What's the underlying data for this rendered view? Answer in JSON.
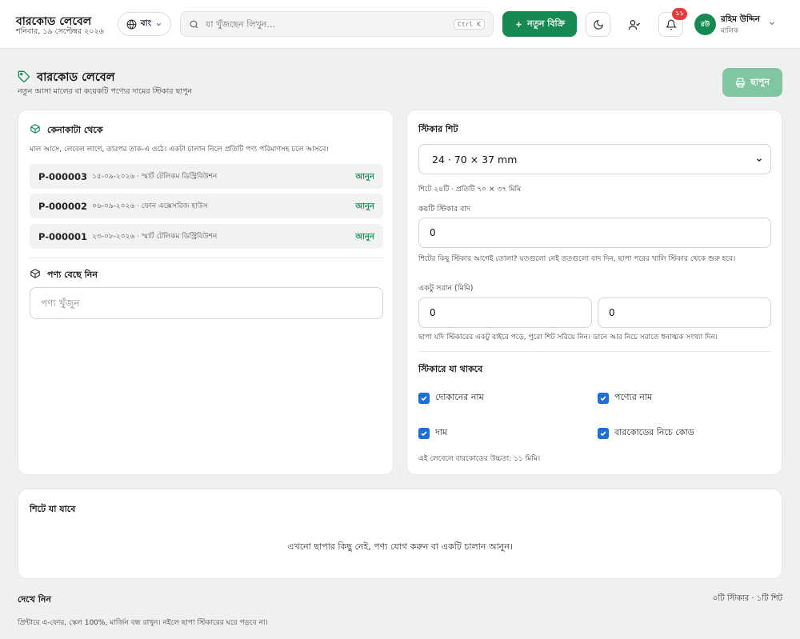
{
  "topbar": {
    "title": "বারকোড লেবেল",
    "date": "শনিবার, ১৯ সেপ্টেম্বর ২০২৬",
    "lang_label": "বাং",
    "search_placeholder": "যা খুঁজছেন লিখুন...",
    "search_shortcut": "Ctrl K",
    "new_sale_label": "নতুন বিক্রি",
    "notification_count": "১১",
    "user_initials": "রউ",
    "user_name": "রহিম উদ্দিন",
    "user_role": "মালিক"
  },
  "page": {
    "title": "বারকোড লেবেল",
    "subtitle": "নতুন আসা মালের বা কয়েকটি পণ্যের দামের স্টিকার ছাপুন",
    "print_label": "ছাপুন"
  },
  "purchases": {
    "title": "কেনাকাটা থেকে",
    "hint": "মাল আসে, লেবেল লাগে, তারপর তাক-এ ওঠে। একটা চালান নিলে প্রতিটি পণ্য পরিমাণসহ চলে আসবে।",
    "bring_label": "আনুন",
    "items": [
      {
        "code": "P-000003",
        "meta": "১৫-০৯-২০২৬ · স্মার্ট টেলিকম ডিস্ট্রিবিউশন"
      },
      {
        "code": "P-000002",
        "meta": "০৬-০৯-২০২৬ · ফোন এক্সেসরিজ হাউস"
      },
      {
        "code": "P-000001",
        "meta": "২৩-০৮-২০২৬ · স্মার্ট টেলিকম ডিস্ট্রিবিউশন"
      }
    ]
  },
  "product_pick": {
    "title": "পণ্য বেছে নিন",
    "search_placeholder": "পণ্য খুঁজুন"
  },
  "sticker_sheet": {
    "title": "স্টিকার শিট",
    "selected": "24 · 70 × 37 mm",
    "sheet_info": "শিটে ২৪টি · প্রতিটি ৭০ × ৩৭ মিমি",
    "skip_label": "কয়টি স্টিকার বাদ",
    "skip_value": "0",
    "skip_hint": "শিটের কিছু স্টিকার আগেই তোলা? যতগুলো নেই ততগুলো বাদ দিন, ছাপা পরের খালি স্টিকার থেকে শুরু হবে।",
    "offset_label": "একটু সরান (মিমি)",
    "offset_x": "0",
    "offset_y": "0",
    "offset_hint": "ছাপা যদি স্টিকারের একটু বাইরে পড়ে, পুরো শিট সরিয়ে নিন। ডানে আর নিচে সরাতে ধনাত্মক সংখ্যা দিন।"
  },
  "sticker_content": {
    "title": "স্টিকারে যা থাকবে",
    "options": {
      "shop_name": "দোকানের নাম",
      "product_name": "পণ্যের নাম",
      "price": "দাম",
      "code_below": "বারকোডের নিচে কোড"
    },
    "barcode_height_note": "এই লেবেলে বারকোডের উচ্চতা: ১১ মিমি।"
  },
  "sheet_content": {
    "title": "শিটে যা যাবে",
    "empty": "এখনো ছাপার কিছু নেই, পণ্য যোগ করুন বা একটি চালান আনুন।"
  },
  "preview": {
    "title": "দেখে নিন",
    "count": "০টি স্টিকার · ১টি শিট",
    "note": "প্রিন্টারে এ-ফোর, স্কেল 100%, মার্জিন বন্ধ রাখুন। নইলে ছাপা স্টিকারের ঘরে পড়বে না।"
  },
  "colors": {
    "brand": "#168a52",
    "print_disabled": "#7fc6a1",
    "badge": "#e23b3b",
    "checkbox": "#1d6fd8"
  }
}
